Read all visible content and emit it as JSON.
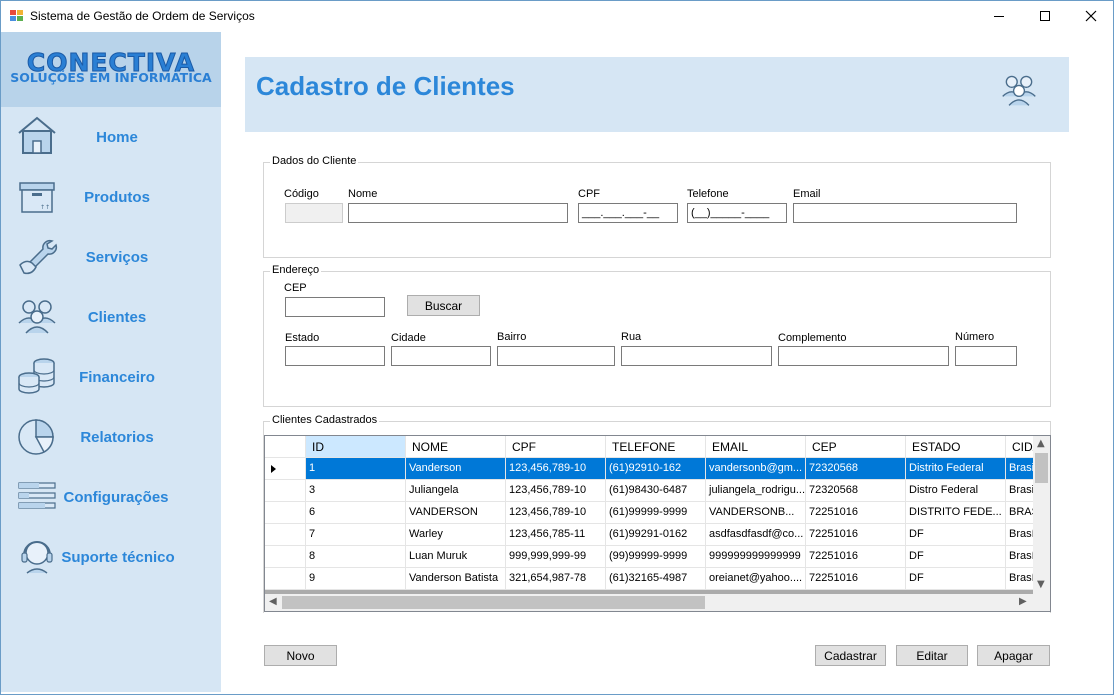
{
  "window": {
    "title": "Sistema de Gestão de Ordem de Serviços"
  },
  "logo": {
    "main": "CONECTIVA",
    "sub": "SOLUÇÕES EM INFORMÁTICA"
  },
  "sidebar": {
    "items": [
      {
        "label": "Home",
        "icon": "home-icon"
      },
      {
        "label": "Produtos",
        "icon": "box-icon"
      },
      {
        "label": "Serviços",
        "icon": "wrench-icon"
      },
      {
        "label": "Clientes",
        "icon": "users-icon"
      },
      {
        "label": "Financeiro",
        "icon": "coins-icon"
      },
      {
        "label": "Relatorios",
        "icon": "pie-chart-icon"
      },
      {
        "label": "Configurações",
        "icon": "sliders-icon"
      },
      {
        "label": "Suporte técnico",
        "icon": "headset-icon"
      }
    ]
  },
  "header": {
    "title": "Cadastro de Clientes",
    "icon": "users-icon"
  },
  "dados": {
    "legend": "Dados do Cliente",
    "codigo_label": "Código",
    "nome_label": "Nome",
    "cpf_label": "CPF",
    "telefone_label": "Telefone",
    "email_label": "Email",
    "codigo_value": "",
    "nome_value": "",
    "cpf_mask": "___.___.___-__",
    "telefone_mask": "(__)_____-____",
    "email_value": ""
  },
  "endereco": {
    "legend": "Endereço",
    "cep_label": "CEP",
    "buscar_button": "Buscar",
    "estado_label": "Estado",
    "cidade_label": "Cidade",
    "bairro_label": "Bairro",
    "rua_label": "Rua",
    "complemento_label": "Complemento",
    "numero_label": "Número"
  },
  "clientes": {
    "legend": "Clientes Cadastrados",
    "columns": [
      "ID",
      "NOME",
      "CPF",
      "TELEFONE",
      "EMAIL",
      "CEP",
      "ESTADO",
      "CIDA"
    ],
    "rows": [
      [
        "1",
        "Vanderson",
        "123,456,789-10",
        "(61)92910-162",
        "vandersonb@gm...",
        "72320568",
        "Distrito Federal",
        "Brasil"
      ],
      [
        "3",
        "Juliangela",
        "123,456,789-10",
        "(61)98430-6487",
        "juliangela_rodrigu...",
        "72320568",
        "Distro Federal",
        "Brasil"
      ],
      [
        "6",
        "VANDERSON",
        "123,456,789-10",
        "(61)99999-9999",
        "VANDERSONB...",
        "72251016",
        "DISTRITO FEDE...",
        "BRAS"
      ],
      [
        "7",
        "Warley",
        "123,456,785-11",
        "(61)99291-0162",
        "asdfasdfasdf@co...",
        "72251016",
        "DF",
        "Brasí"
      ],
      [
        "8",
        "Luan Muruk",
        "999,999,999-99",
        "(99)99999-9999",
        "999999999999999",
        "72251016",
        "DF",
        "Brasí"
      ],
      [
        "9",
        "Vanderson Batista",
        "321,654,987-78",
        "(61)32165-4987",
        "oreianet@yahoo....",
        "72251016",
        "DF",
        "Brasí"
      ]
    ]
  },
  "actions": {
    "novo": "Novo",
    "cadastrar": "Cadastrar",
    "editar": "Editar",
    "apagar": "Apagar"
  },
  "colors": {
    "accent": "#2c87d9",
    "sidebar_bg": "#d6e6f4",
    "logo_bg": "#b8d3ea",
    "selection": "#0078d7"
  }
}
